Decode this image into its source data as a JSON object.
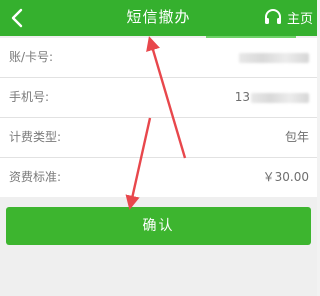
{
  "header": {
    "title": "短信撤办",
    "back_icon": "chevron-left-icon",
    "home_icon": "headset-icon",
    "home_label": "主页",
    "background": "#35b02e"
  },
  "rows": [
    {
      "label": "账/卡号:",
      "value": "",
      "value_obscured": true
    },
    {
      "label": "手机号:",
      "value": "13",
      "value_obscured": true
    },
    {
      "label": "计费类型:",
      "value": "包年",
      "value_obscured": false
    },
    {
      "label": "资费标准:",
      "value": "￥30.00",
      "value_obscured": false
    }
  ],
  "confirm_button": {
    "label": "确认",
    "background": "#3db52f"
  },
  "annotation": {
    "arrow_color": "#e8474c"
  }
}
